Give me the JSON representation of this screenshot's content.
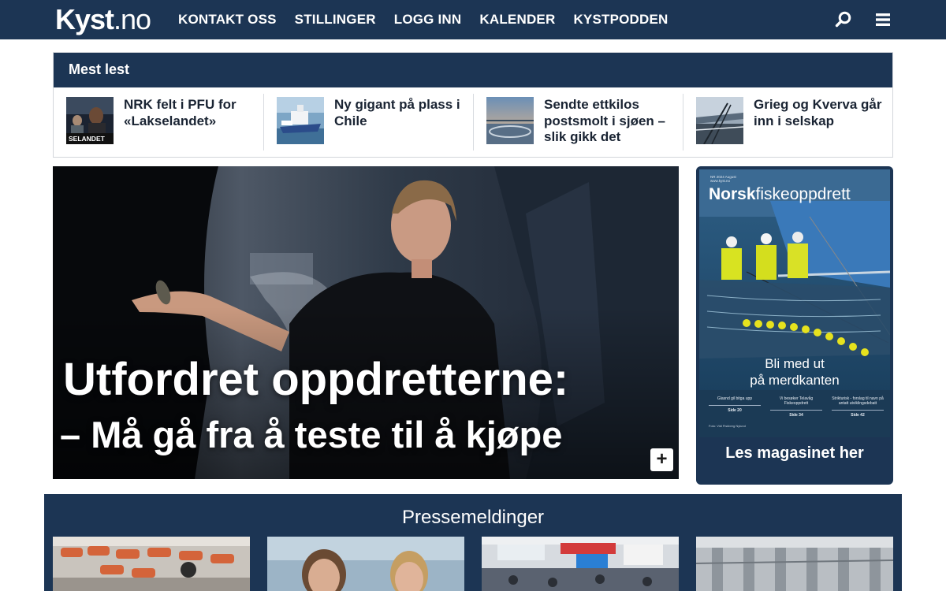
{
  "header": {
    "logo_bold": "Kyst",
    "logo_thin": ".no",
    "nav": [
      "KONTAKT OSS",
      "STILLINGER",
      "LOGG INN",
      "KALENDER",
      "KYSTPODDEN"
    ],
    "icons": [
      "search-icon",
      "hamburger-menu-icon"
    ]
  },
  "most_read": {
    "heading": "Mest lest",
    "items": [
      {
        "title": "NRK felt i PFU for «Lakselandet»",
        "thumb_caption": "SELANDET"
      },
      {
        "title": "Ny gigant på plass i Chile"
      },
      {
        "title": "Sendte ettkilos postsmolt i sjøen – slik gikk det"
      },
      {
        "title": "Grieg og Kverva går inn i selskap"
      }
    ]
  },
  "hero": {
    "title": "Utfordret oppdretterne:",
    "subtitle": "– Må gå fra å teste til å kjøpe",
    "expand_symbol": "+"
  },
  "magazine": {
    "cover_small_line1": "NR 2024 August",
    "cover_small_line2": "www.kyst.no",
    "name_bold": "Norsk",
    "name_thin": "fiskeoppdrett",
    "cover_blurb_line1": "Bli med ut",
    "cover_blurb_line2": "på merdkanten",
    "toc": [
      {
        "text": "Glasnd gil bitga upp",
        "page": "Side 20"
      },
      {
        "text": "Vi besøker Telavåg Fiskeoppdrett",
        "page": "Side 34"
      },
      {
        "text": "Strikturisk - forslag til navn på antatt utviklingsdebatt",
        "page": "Side 42"
      }
    ],
    "cover_footer": "Foto: Vidi Fiskberg Nylund",
    "link_label": "Les magasinet her"
  },
  "press": {
    "heading": "Pressemeldinger"
  },
  "colors": {
    "brand_navy": "#1c3554",
    "text_dark": "#1a2433",
    "white": "#ffffff"
  }
}
